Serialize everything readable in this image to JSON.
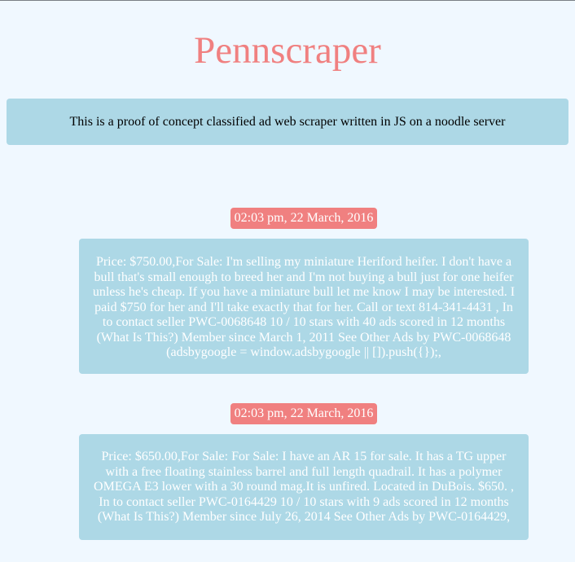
{
  "page": {
    "title": "Pennscraper",
    "intro": "This is a proof of concept classified ad web scraper written in JS on a noodle server"
  },
  "ads": [
    {
      "timestamp": "02:03 pm, 22 March, 2016",
      "text": "Price: $750.00,For Sale: I'm selling my miniature Heriford heifer. I don't have a bull that's small enough to breed her and I'm not buying a bull just for one heifer unless he's cheap. If you have a miniature bull let me know I may be interested. I paid $750 for her and I'll take exactly that for her. Call or text 814-341-4431 , In to contact seller PWC-0068648 10 / 10 stars with 40 ads scored in 12 months (What Is This?) Member since March 1, 2011 See Other Ads by PWC-0068648 (adsbygoogle = window.adsbygoogle || []).push({});,"
    },
    {
      "timestamp": "02:03 pm, 22 March, 2016",
      "text": "Price: $650.00,For Sale: For Sale: I have an AR 15 for sale. It has a TG upper with a free floating stainless barrel and full length quadrail. It has a polymer OMEGA E3 lower with a 30 round mag.It is unfired. Located in DuBois. $650. , In to contact seller PWC-0164429 10 / 10 stars with 9 ads scored in 12 months (What Is This?) Member since July 26, 2014 See Other Ads by PWC-0164429,"
    }
  ]
}
